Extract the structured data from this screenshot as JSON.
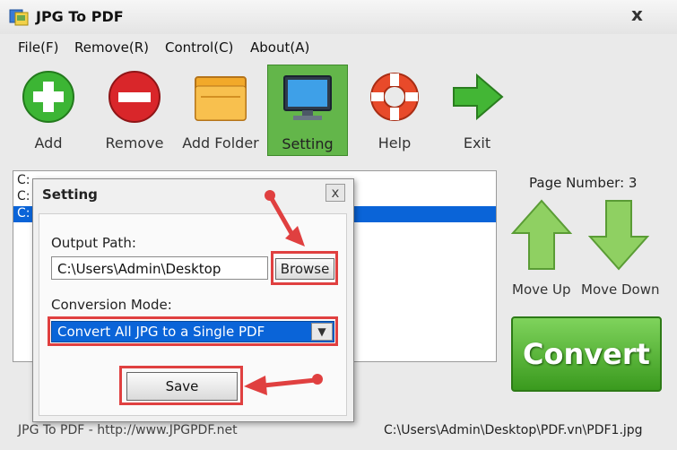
{
  "window": {
    "title": "JPG To PDF",
    "close_glyph": "x"
  },
  "menu": [
    {
      "label": "File(F)"
    },
    {
      "label": "Remove(R)"
    },
    {
      "label": "Control(C)"
    },
    {
      "label": "About(A)"
    }
  ],
  "toolbar": [
    {
      "label": "Add",
      "icon": "add-icon"
    },
    {
      "label": "Remove",
      "icon": "remove-icon"
    },
    {
      "label": "Add Folder",
      "icon": "folder-icon"
    },
    {
      "label": "Setting",
      "icon": "monitor-icon",
      "active": true
    },
    {
      "label": "Help",
      "icon": "lifebuoy-icon"
    },
    {
      "label": "Exit",
      "icon": "exit-arrow-icon"
    }
  ],
  "file_list": {
    "rows": [
      "C:",
      "C:",
      "C:"
    ],
    "selected_index": 2
  },
  "side": {
    "page_number": "Page Number: 3",
    "move_up": "Move Up",
    "move_down": "Move Down",
    "convert": "Convert"
  },
  "status": {
    "left": "JPG To PDF - http://www.JPGPDF.net",
    "right": "C:\\Users\\Admin\\Desktop\\PDF.vn\\PDF1.jpg"
  },
  "dialog": {
    "title": "Setting",
    "close_glyph": "x",
    "output_path_label": "Output Path:",
    "output_path_value": "C:\\Users\\Admin\\Desktop",
    "browse_label": "Browse",
    "conversion_mode_label": "Conversion Mode:",
    "conversion_mode_value": "Convert All JPG to a Single PDF",
    "save_label": "Save"
  },
  "colors": {
    "accent_green": "#63b64a",
    "selection_blue": "#0a64d8",
    "highlight_red": "#e04040"
  }
}
